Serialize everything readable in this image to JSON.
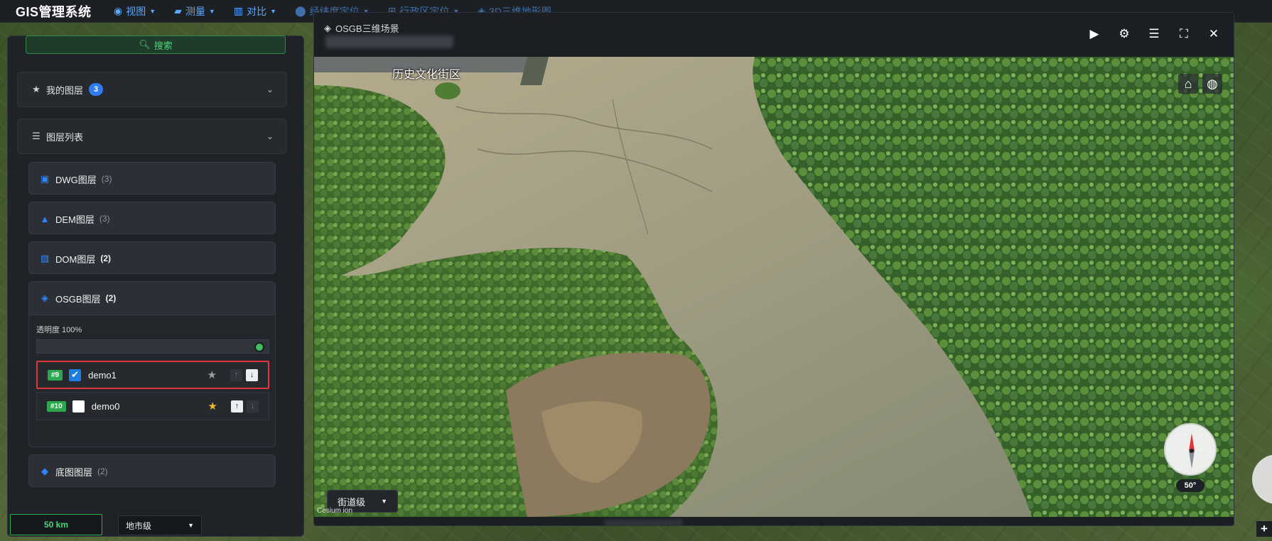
{
  "app": {
    "title": "GIS管理系统"
  },
  "nav": [
    {
      "label": "视图",
      "icon": "eye-icon"
    },
    {
      "label": "测量",
      "icon": "ruler-icon"
    },
    {
      "label": "对比",
      "icon": "columns-icon"
    },
    {
      "label": "经纬度定位",
      "icon": "map-pin-icon"
    },
    {
      "label": "行政区定位",
      "icon": "sitemap-icon"
    },
    {
      "label": "3D三维地形图",
      "icon": "cube-icon"
    }
  ],
  "left_panel": {
    "search_label": "搜索",
    "my_layers": {
      "label": "我的图层",
      "count": "3"
    },
    "layer_list": {
      "label": "图层列表",
      "groups": [
        {
          "label": "DWG图层",
          "count": "(3)",
          "icon": "dwg-icon"
        },
        {
          "label": "DEM图层",
          "count": "(3)",
          "icon": "triangle-icon"
        },
        {
          "label": "DOM图层",
          "count": "(2)",
          "icon": "image-icon"
        },
        {
          "label": "OSGB图层",
          "count": "(2)",
          "icon": "cube-icon"
        },
        {
          "label": "底图图层",
          "count": "(2)",
          "icon": "layers-icon"
        }
      ],
      "osgb": {
        "opacity_label": "透明度 100%",
        "opacity_value": 100,
        "items": [
          {
            "id": "#9",
            "name": "demo1",
            "checked": true,
            "favorite": false
          },
          {
            "id": "#10",
            "name": "demo0",
            "checked": false,
            "favorite": true
          }
        ]
      }
    }
  },
  "footer": {
    "scale": "50 km",
    "level": "地市级"
  },
  "scene": {
    "title": "OSGB三维场景",
    "place_label": "历史文化街区",
    "compass_deg": "50°",
    "street_level": "街道级",
    "credit": "Cesium ion",
    "tools": [
      "play-icon",
      "gear-icon",
      "sliders-icon",
      "fullscreen-icon",
      "close-icon"
    ]
  },
  "colors": {
    "accent_blue": "#59a8ff",
    "accent_green": "#2ea84f",
    "selection_red": "#e0353a",
    "panel_bg": "#1f2226"
  }
}
